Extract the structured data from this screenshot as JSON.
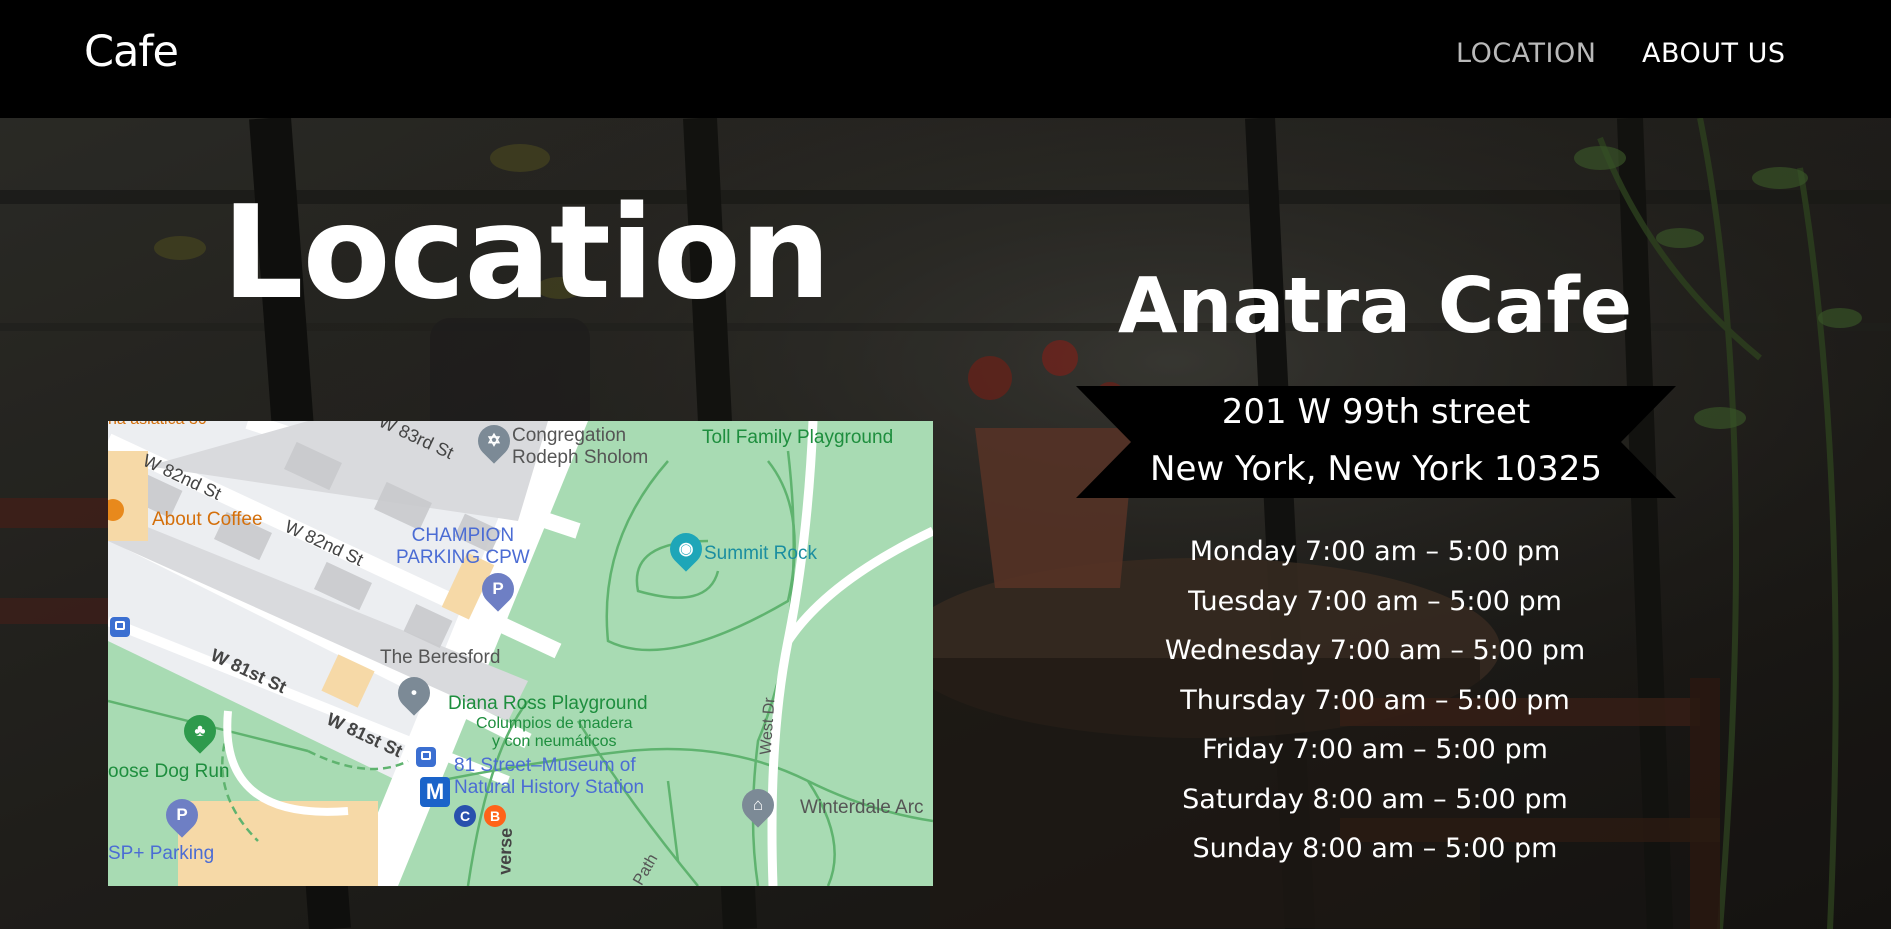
{
  "brand": "Cafe",
  "nav": {
    "location": "LOCATION",
    "about": "ABOUT US"
  },
  "page_title": "Location",
  "cafe": {
    "name": "Anatra Cafe",
    "address_line1": "201 W 99th street",
    "address_line2": "New York, New York 10325"
  },
  "hours": [
    "Monday 7:00 am – 5:00 pm",
    "Tuesday 7:00 am – 5:00 pm",
    "Wednesday 7:00 am – 5:00 pm",
    "Thursday 7:00 am – 5:00 pm",
    "Friday 7:00 am – 5:00 pm",
    "Saturday 8:00 am – 5:00 pm",
    "Sunday 8:00 am – 5:00 pm"
  ],
  "map": {
    "labels": {
      "top_left": "na asiatica   30",
      "congregation": "Congregation\nRodeph Sholom",
      "toll": "Toll Family Playground",
      "w83": "W 83rd St",
      "w82a": "W 82nd St",
      "w82b": "W 82nd St",
      "about_coffee": "About Coffee",
      "champion": "CHAMPION\nPARKING CPW",
      "summit": "Summit Rock",
      "beresford": "The Beresford",
      "w81a": "W 81st St",
      "w81b": "W 81st St",
      "diana": "Diana Ross Playground",
      "columpios": "Columpios de madera\ny con neumáticos",
      "station": "81 Street–Museum of\nNatural History Station",
      "west_dr": "West Dr",
      "winterdale": "Winterdale Arc",
      "dog_run": "oose Dog Run",
      "sp_parking": "SP+ Parking",
      "traverse": "verse",
      "path": "Path",
      "metro": "M",
      "line_c": "C",
      "line_b": "B",
      "parking": "P"
    }
  },
  "colors": {
    "navbar": "#000000",
    "nav_active": "#b9b9b9",
    "park": "#a8dbb3",
    "park_path": "#5fb36f",
    "metro": "#1a63c9",
    "line_c": "#2850ad",
    "line_b": "#ff6319"
  }
}
